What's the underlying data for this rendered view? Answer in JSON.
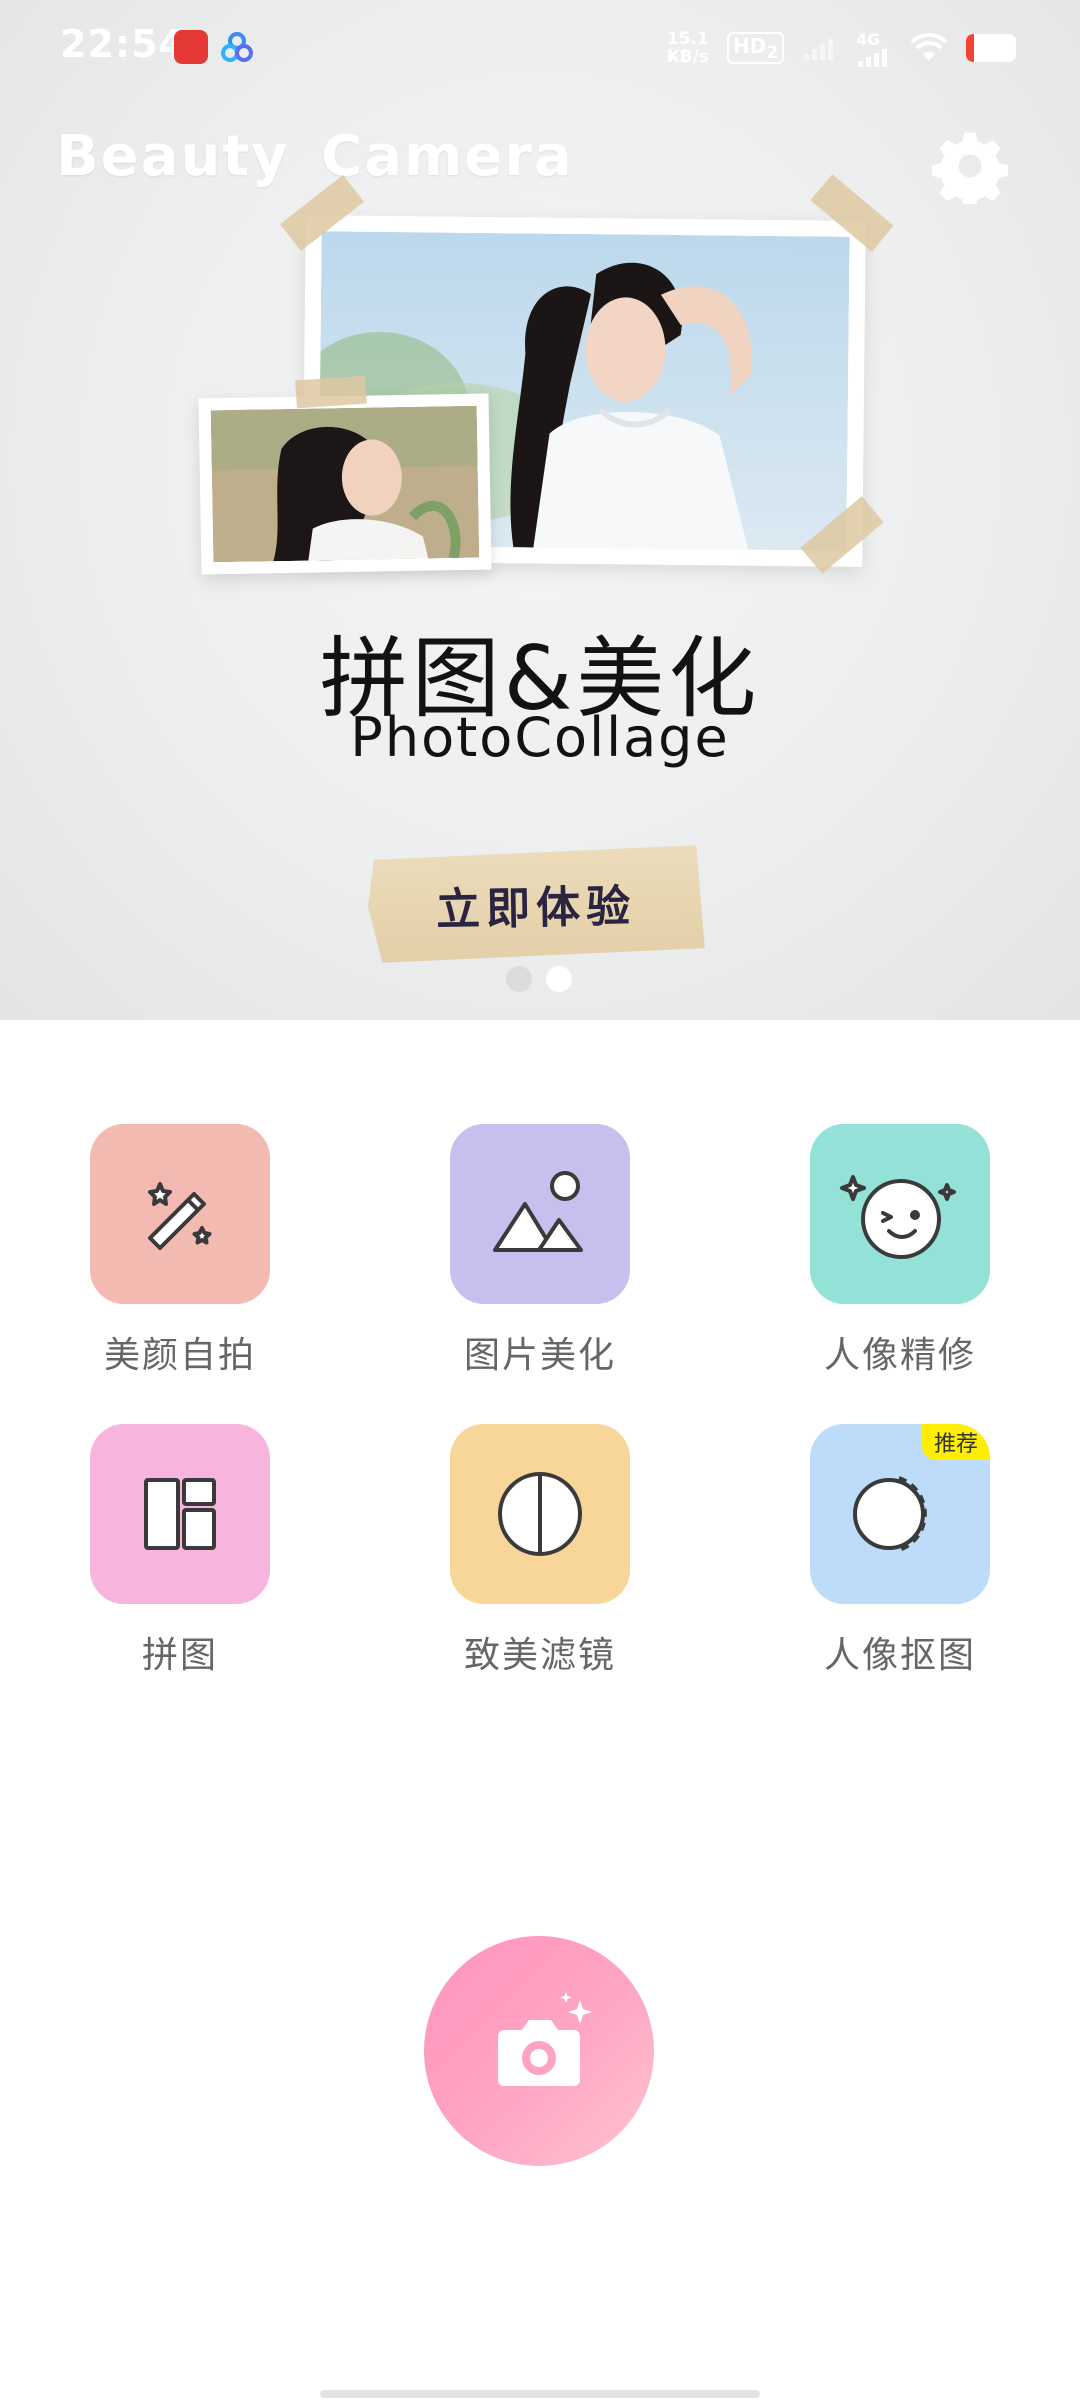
{
  "status_bar": {
    "time": "22:54",
    "net_speed_value": "15.1",
    "net_speed_unit": "KB/s",
    "hd_label": "HD",
    "hd_sub": "2",
    "network_type": "4G",
    "battery_level": 0.15
  },
  "header": {
    "app_title": "Beauty  Camera"
  },
  "banner": {
    "title": "拼图&美化",
    "subtitle": "PhotoCollage",
    "cta_label": "立即体验",
    "page_count": 2,
    "active_page": 2
  },
  "features": [
    {
      "id": "beauty-selfie",
      "label": "美颜自拍",
      "color": "#f2bab0",
      "icon": "magic-wand-icon"
    },
    {
      "id": "photo-beautify",
      "label": "图片美化",
      "color": "#c9bfee",
      "icon": "landscape-icon"
    },
    {
      "id": "portrait-retouch",
      "label": "人像精修",
      "color": "#93e1d7",
      "icon": "wink-face-icon"
    },
    {
      "id": "collage",
      "label": "拼图",
      "color": "#f7b4dc",
      "icon": "collage-layout-icon"
    },
    {
      "id": "filters",
      "label": "致美滤镜",
      "color": "#f8d598",
      "icon": "half-circle-icon"
    },
    {
      "id": "portrait-cutout",
      "label": "人像抠图",
      "color": "#bcdcfa",
      "icon": "cutout-circle-icon",
      "badge": "推荐"
    }
  ],
  "shutter": {
    "icon": "camera-sparkle-icon"
  },
  "colors": {
    "accent_pink": "#ff9fc3",
    "label_gray": "#666666",
    "badge_yellow": "#ffee00"
  }
}
